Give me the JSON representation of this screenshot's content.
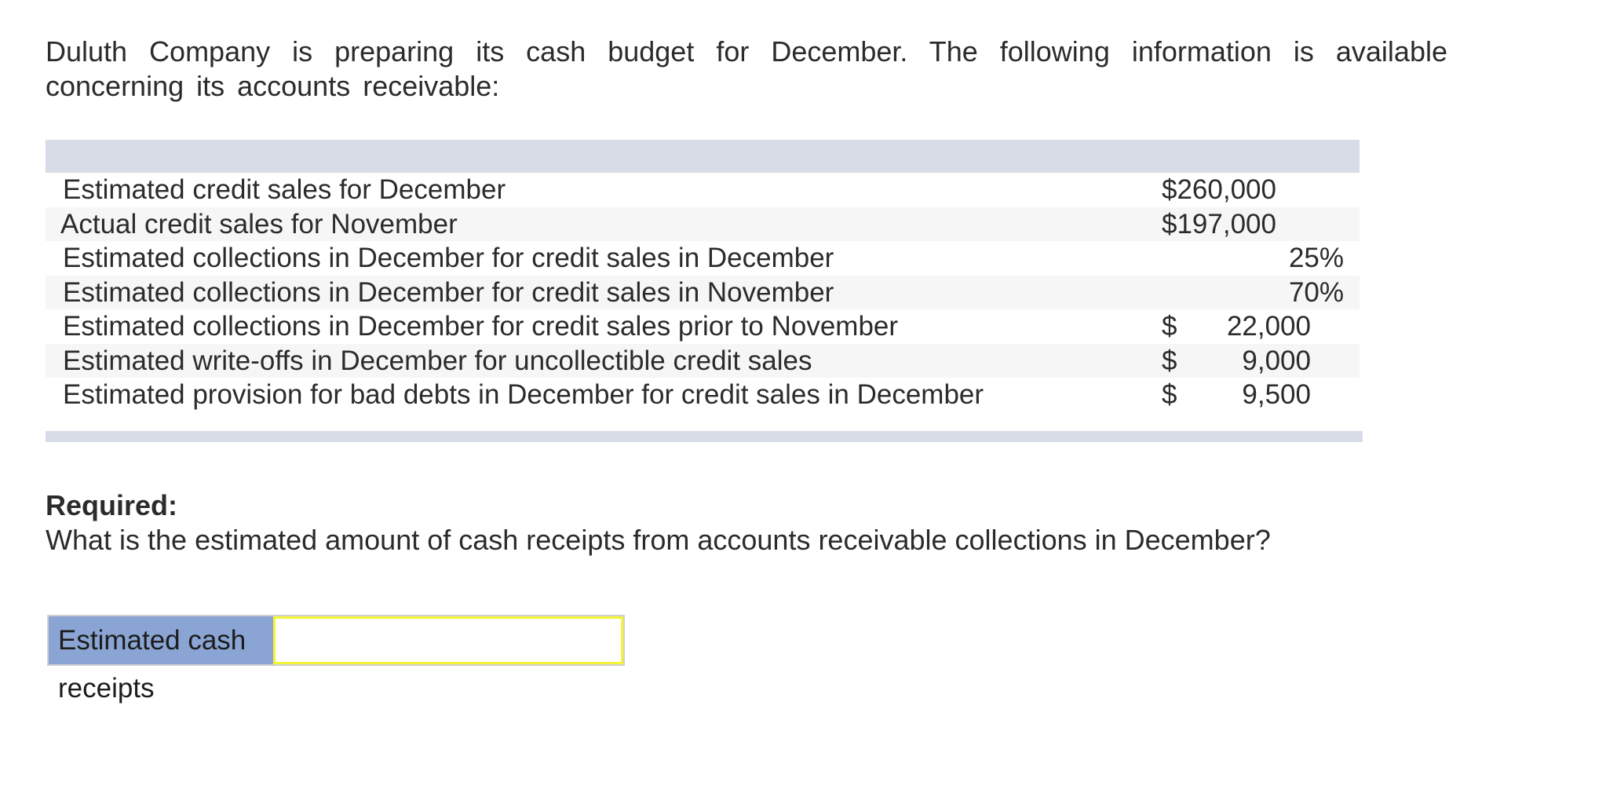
{
  "intro": {
    "line1": "Duluth Company is preparing its cash budget for December. The following information is available",
    "line2": "concerning its accounts receivable:"
  },
  "table": {
    "rows": [
      {
        "label": "Estimated credit sales for December",
        "currency": "$",
        "amount": "260,000",
        "type": "money-tight"
      },
      {
        "label": "Actual credit sales for November",
        "currency": "$",
        "amount": "197,000",
        "type": "money-tight"
      },
      {
        "label": "Estimated collections in December for credit sales in December",
        "value": "25%",
        "type": "pct"
      },
      {
        "label": "Estimated collections in December for credit sales in November",
        "value": "70%",
        "type": "pct"
      },
      {
        "label": "Estimated collections in December for credit sales prior to November",
        "currency": "$",
        "amount": "22,000",
        "type": "money"
      },
      {
        "label": "Estimated write-offs in December for uncollectible credit sales",
        "currency": "$",
        "amount": "9,000",
        "type": "money"
      },
      {
        "label": "Estimated provision for bad debts in December for credit sales in December",
        "currency": "$",
        "amount": "9,500",
        "type": "money"
      }
    ]
  },
  "required": {
    "title": "Required:",
    "question": "What is the estimated amount of cash receipts from accounts receivable collections in December?"
  },
  "answer": {
    "label": "Estimated cash receipts",
    "value": ""
  }
}
